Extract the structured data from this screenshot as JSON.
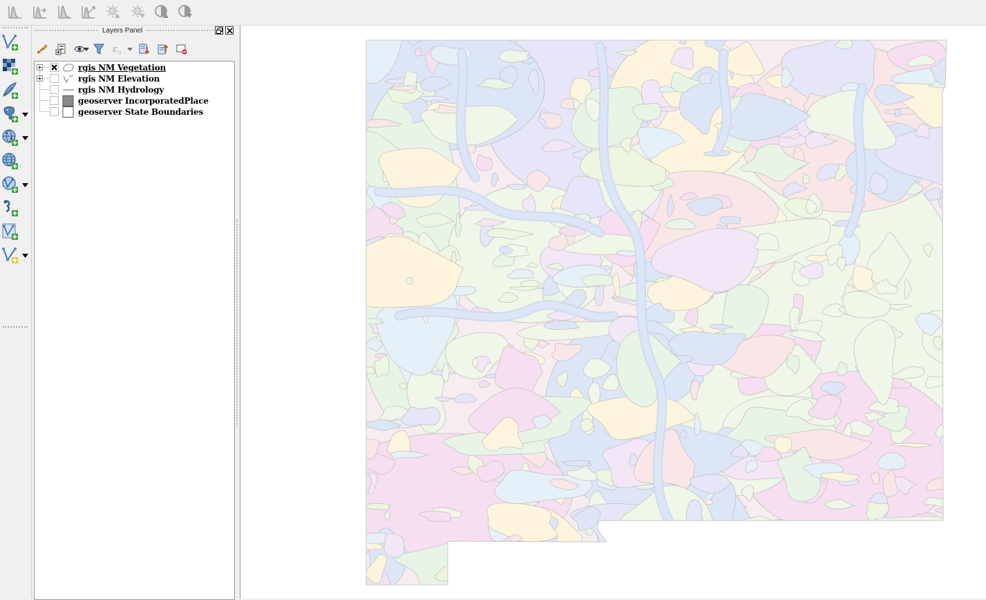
{
  "top_toolbar": {
    "buttons": [
      {
        "name": "histogram-icon"
      },
      {
        "name": "histogram-stretch-icon"
      },
      {
        "name": "histogram-cumulative-icon"
      },
      {
        "name": "histogram-stretch-cumulative-icon"
      },
      {
        "name": "brightness-increase-icon"
      },
      {
        "name": "brightness-decrease-icon"
      },
      {
        "name": "contrast-increase-icon"
      },
      {
        "name": "contrast-decrease-icon"
      }
    ]
  },
  "left_toolbar": {
    "buttons": [
      {
        "name": "add-vector-layer-icon",
        "dropdown": false
      },
      {
        "name": "add-raster-layer-icon",
        "dropdown": false
      },
      {
        "name": "add-spatialite-layer-icon",
        "dropdown": false
      },
      {
        "name": "add-postgis-layer-icon",
        "dropdown": true
      },
      {
        "name": "add-wms-layer-icon",
        "dropdown": true
      },
      {
        "name": "add-wcs-layer-icon",
        "dropdown": false
      },
      {
        "name": "add-wfs-layer-icon",
        "dropdown": true
      },
      {
        "name": "add-delimited-text-layer-icon",
        "dropdown": false
      },
      {
        "name": "new-shapefile-layer-icon",
        "dropdown": false
      },
      {
        "name": "new-spatialite-layer-icon",
        "dropdown": true
      }
    ]
  },
  "layers_panel": {
    "title": "Layers Panel",
    "toolbar": [
      {
        "name": "style-manager-icon"
      },
      {
        "name": "add-group-icon"
      },
      {
        "name": "visibility-eye-icon"
      },
      {
        "name": "filter-legend-icon"
      },
      {
        "name": "filter-expression-icon"
      },
      {
        "name": "expand-all-icon"
      },
      {
        "name": "collapse-all-icon"
      },
      {
        "name": "remove-layer-icon"
      }
    ],
    "layers": [
      {
        "label": "rgis NM Vegetation",
        "checked": true,
        "expandable": true,
        "symbol": "polygon-icon",
        "active": true
      },
      {
        "label": "rgis NM Elevation",
        "checked": false,
        "expandable": true,
        "symbol": "raster-line-icon",
        "active": false
      },
      {
        "label": "rgis NM Hydrology",
        "checked": false,
        "expandable": false,
        "symbol": "line-icon",
        "active": false
      },
      {
        "label": "geoserver IncorporatedPlace",
        "checked": false,
        "expandable": false,
        "symbol": "grey-fill-icon",
        "active": false
      },
      {
        "label": "geoserver State Boundaries",
        "checked": false,
        "expandable": false,
        "symbol": "white-fill-icon",
        "active": false
      }
    ]
  },
  "map": {
    "palette": [
      "#f6dff0",
      "#e6e6f8",
      "#dde6f7",
      "#f9e6e6",
      "#eef5e0",
      "#fdf4dd",
      "#e8f5e6",
      "#f2e6f7",
      "#e6f0f8",
      "#f0f6e8"
    ],
    "outline_color": "#bdbdbd"
  }
}
